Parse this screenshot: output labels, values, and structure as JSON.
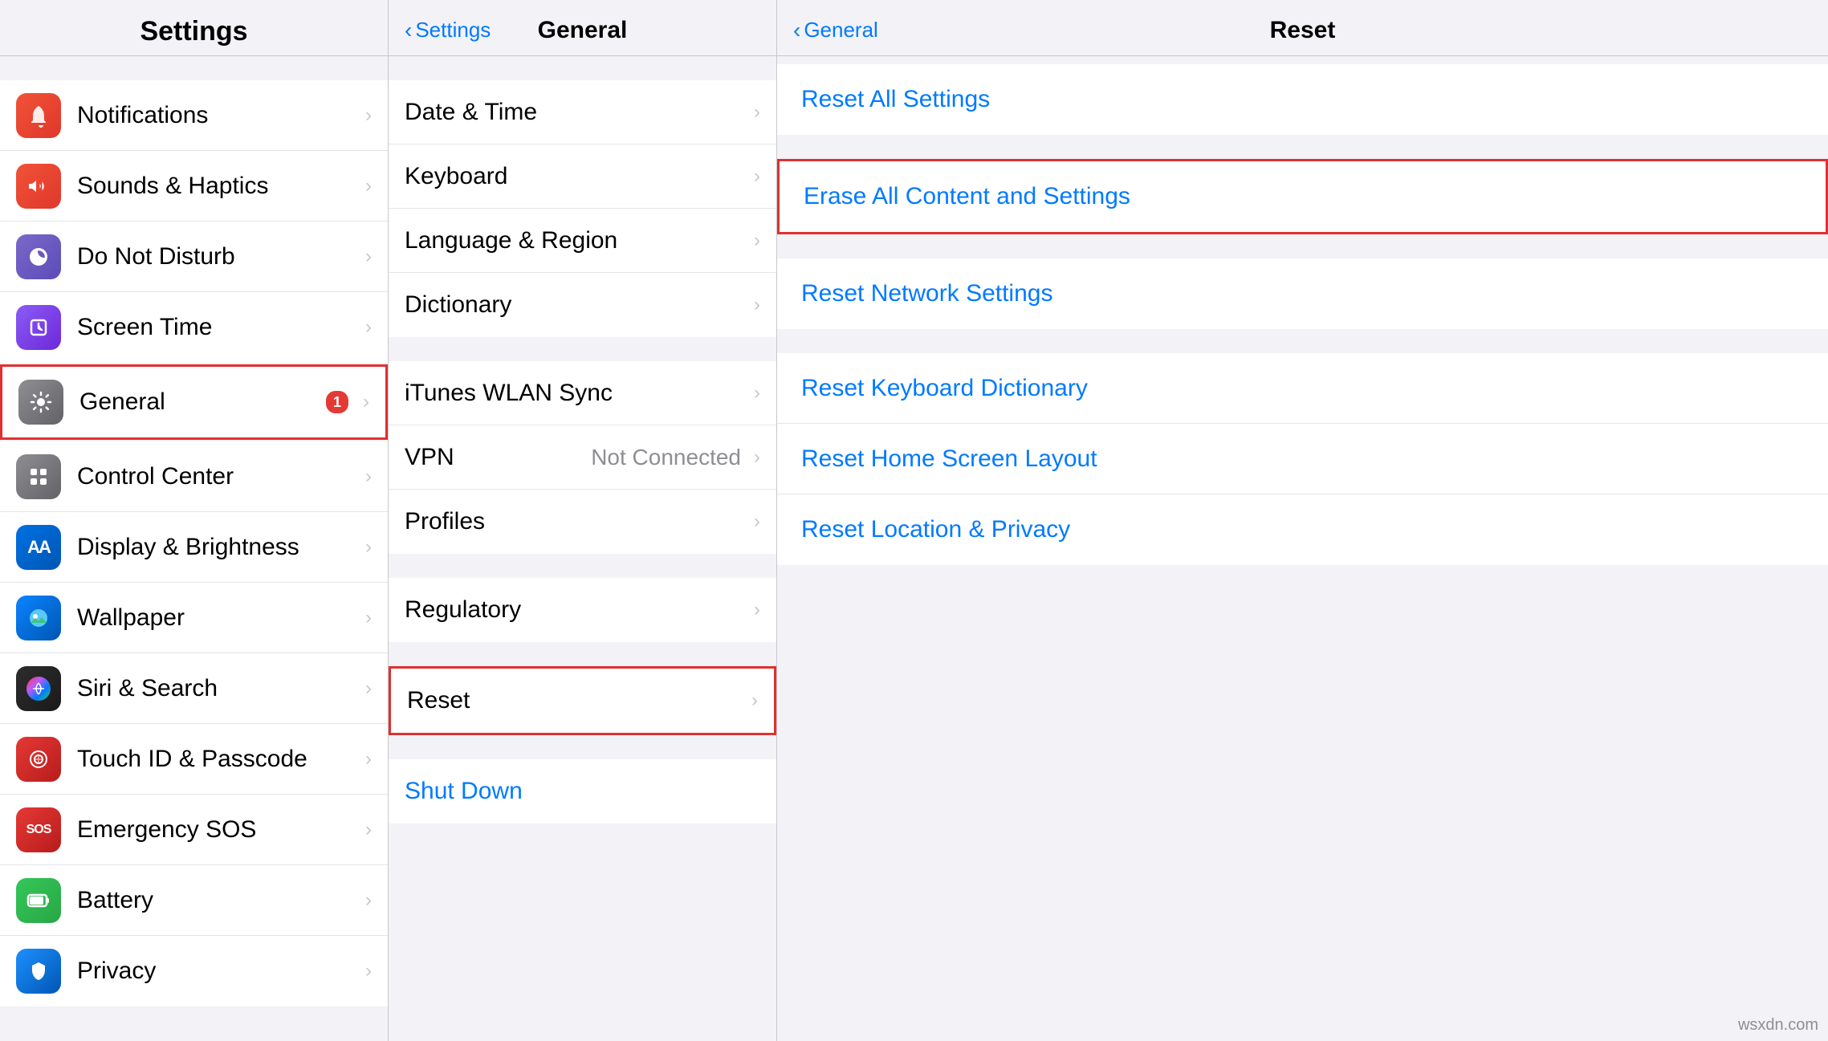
{
  "colors": {
    "blue": "#007aff",
    "red": "#e53935",
    "highlight_border": "#e03030",
    "gray": "#8e8e93",
    "separator": "#e5e5ea"
  },
  "settings_panel": {
    "title": "Settings",
    "sections": [
      {
        "items": [
          {
            "id": "notifications",
            "label": "Notifications",
            "icon_class": "icon-notifications",
            "icon_char": "🔔",
            "badge": null
          },
          {
            "id": "sounds",
            "label": "Sounds & Haptics",
            "icon_class": "icon-sounds",
            "icon_char": "🔊",
            "badge": null
          },
          {
            "id": "donotdisturb",
            "label": "Do Not Disturb",
            "icon_class": "icon-donotdisturb",
            "icon_char": "🌙",
            "badge": null
          },
          {
            "id": "screentime",
            "label": "Screen Time",
            "icon_class": "icon-screentime",
            "icon_char": "⏱",
            "badge": null
          }
        ]
      },
      {
        "items": [
          {
            "id": "general",
            "label": "General",
            "icon_class": "icon-general",
            "icon_char": "⚙️",
            "badge": "1",
            "highlighted": true
          }
        ]
      },
      {
        "items": [
          {
            "id": "controlcenter",
            "label": "Control Center",
            "icon_class": "icon-controlcenter",
            "icon_char": "⊞",
            "badge": null
          },
          {
            "id": "displaybrightness",
            "label": "Display & Brightness",
            "icon_class": "icon-displaybrightness",
            "icon_char": "AA",
            "badge": null
          },
          {
            "id": "wallpaper",
            "label": "Wallpaper",
            "icon_class": "icon-wallpaper",
            "icon_char": "🌸",
            "badge": null
          },
          {
            "id": "siri",
            "label": "Siri & Search",
            "icon_class": "icon-siri",
            "icon_char": "✦",
            "badge": null
          },
          {
            "id": "touchid",
            "label": "Touch ID & Passcode",
            "icon_class": "icon-touchid",
            "icon_char": "☝",
            "badge": null
          },
          {
            "id": "sos",
            "label": "Emergency SOS",
            "icon_class": "icon-sos",
            "icon_char": "SOS",
            "badge": null
          },
          {
            "id": "battery",
            "label": "Battery",
            "icon_class": "icon-battery",
            "icon_char": "🔋",
            "badge": null
          },
          {
            "id": "privacy",
            "label": "Privacy",
            "icon_class": "icon-privacy",
            "icon_char": "✋",
            "badge": null
          }
        ]
      }
    ]
  },
  "general_panel": {
    "back_label": "Settings",
    "title": "General",
    "sections": [
      {
        "items": [
          {
            "id": "date-time",
            "label": "Date & Time",
            "value": null
          },
          {
            "id": "keyboard",
            "label": "Keyboard",
            "value": null
          },
          {
            "id": "language-region",
            "label": "Language & Region",
            "value": null
          },
          {
            "id": "dictionary",
            "label": "Dictionary",
            "value": null
          }
        ]
      },
      {
        "items": [
          {
            "id": "itunes-wlan",
            "label": "iTunes WLAN Sync",
            "value": null
          },
          {
            "id": "vpn",
            "label": "VPN",
            "value": "Not Connected"
          },
          {
            "id": "profiles",
            "label": "Profiles",
            "value": null
          }
        ]
      },
      {
        "items": [
          {
            "id": "regulatory",
            "label": "Regulatory",
            "value": null
          }
        ]
      },
      {
        "items": [
          {
            "id": "reset",
            "label": "Reset",
            "value": null,
            "highlighted": true
          }
        ]
      },
      {
        "items": [
          {
            "id": "shutdown",
            "label": "Shut Down",
            "value": null,
            "is_blue": true
          }
        ]
      }
    ]
  },
  "reset_panel": {
    "back_label": "General",
    "title": "Reset",
    "sections": [
      {
        "items": [
          {
            "id": "reset-all",
            "label": "Reset All Settings"
          }
        ]
      },
      {
        "items": [
          {
            "id": "erase-all",
            "label": "Erase All Content and Settings",
            "highlighted": true
          }
        ]
      },
      {
        "items": [
          {
            "id": "reset-network",
            "label": "Reset Network Settings"
          }
        ]
      },
      {
        "items": [
          {
            "id": "reset-keyboard",
            "label": "Reset Keyboard Dictionary"
          },
          {
            "id": "reset-home",
            "label": "Reset Home Screen Layout"
          },
          {
            "id": "reset-location",
            "label": "Reset Location & Privacy"
          }
        ]
      }
    ]
  },
  "watermark": "wsxdn.com"
}
